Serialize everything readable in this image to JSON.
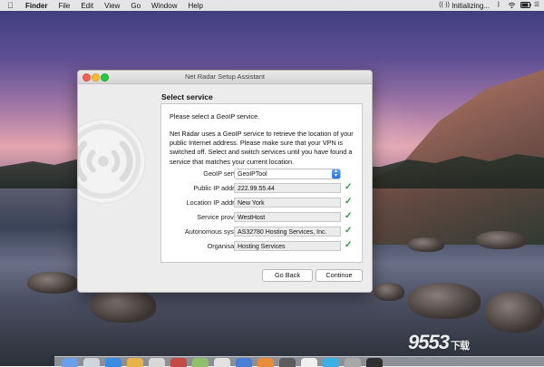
{
  "menubar": {
    "app_name": "Finder",
    "menus": [
      "File",
      "Edit",
      "View",
      "Go",
      "Window",
      "Help"
    ],
    "status_text": "Initializing...",
    "icons": [
      "apple-icon",
      "net-radar-icon",
      "bluetooth-icon",
      "wifi-icon",
      "battery-icon"
    ]
  },
  "window": {
    "title": "Net Radar Setup Assistant",
    "section_title": "Select service",
    "intro": "Please select a GeoIP service.",
    "description": "Net Radar uses a GeoIP service to retrieve the location of your public Internet address. Please make sure that your VPN is switched off. Select and switch services until you have found a service that matches your current location.",
    "fields": {
      "geoip_service": {
        "label": "GeoIP service:",
        "value": "GeoIPTool"
      },
      "public_ip": {
        "label": "Public IP address:",
        "value": "222.99.55.44"
      },
      "location_ip": {
        "label": "Location IP address:",
        "value": "New York"
      },
      "service_provider": {
        "label": "Service provider:",
        "value": "WestHost"
      },
      "autonomous_system": {
        "label": "Autonomous system:",
        "value": "AS32780 Hosting Services, Inc."
      },
      "organisation": {
        "label": "Organisation:",
        "value": "Hosting Services"
      }
    },
    "buttons": {
      "back": "Go Back",
      "continue": "Continue"
    }
  },
  "watermark": {
    "text": "9553",
    "suffix": "下载"
  },
  "colors": {
    "accent": "#1f6fe8",
    "check": "#2e9c3e"
  }
}
